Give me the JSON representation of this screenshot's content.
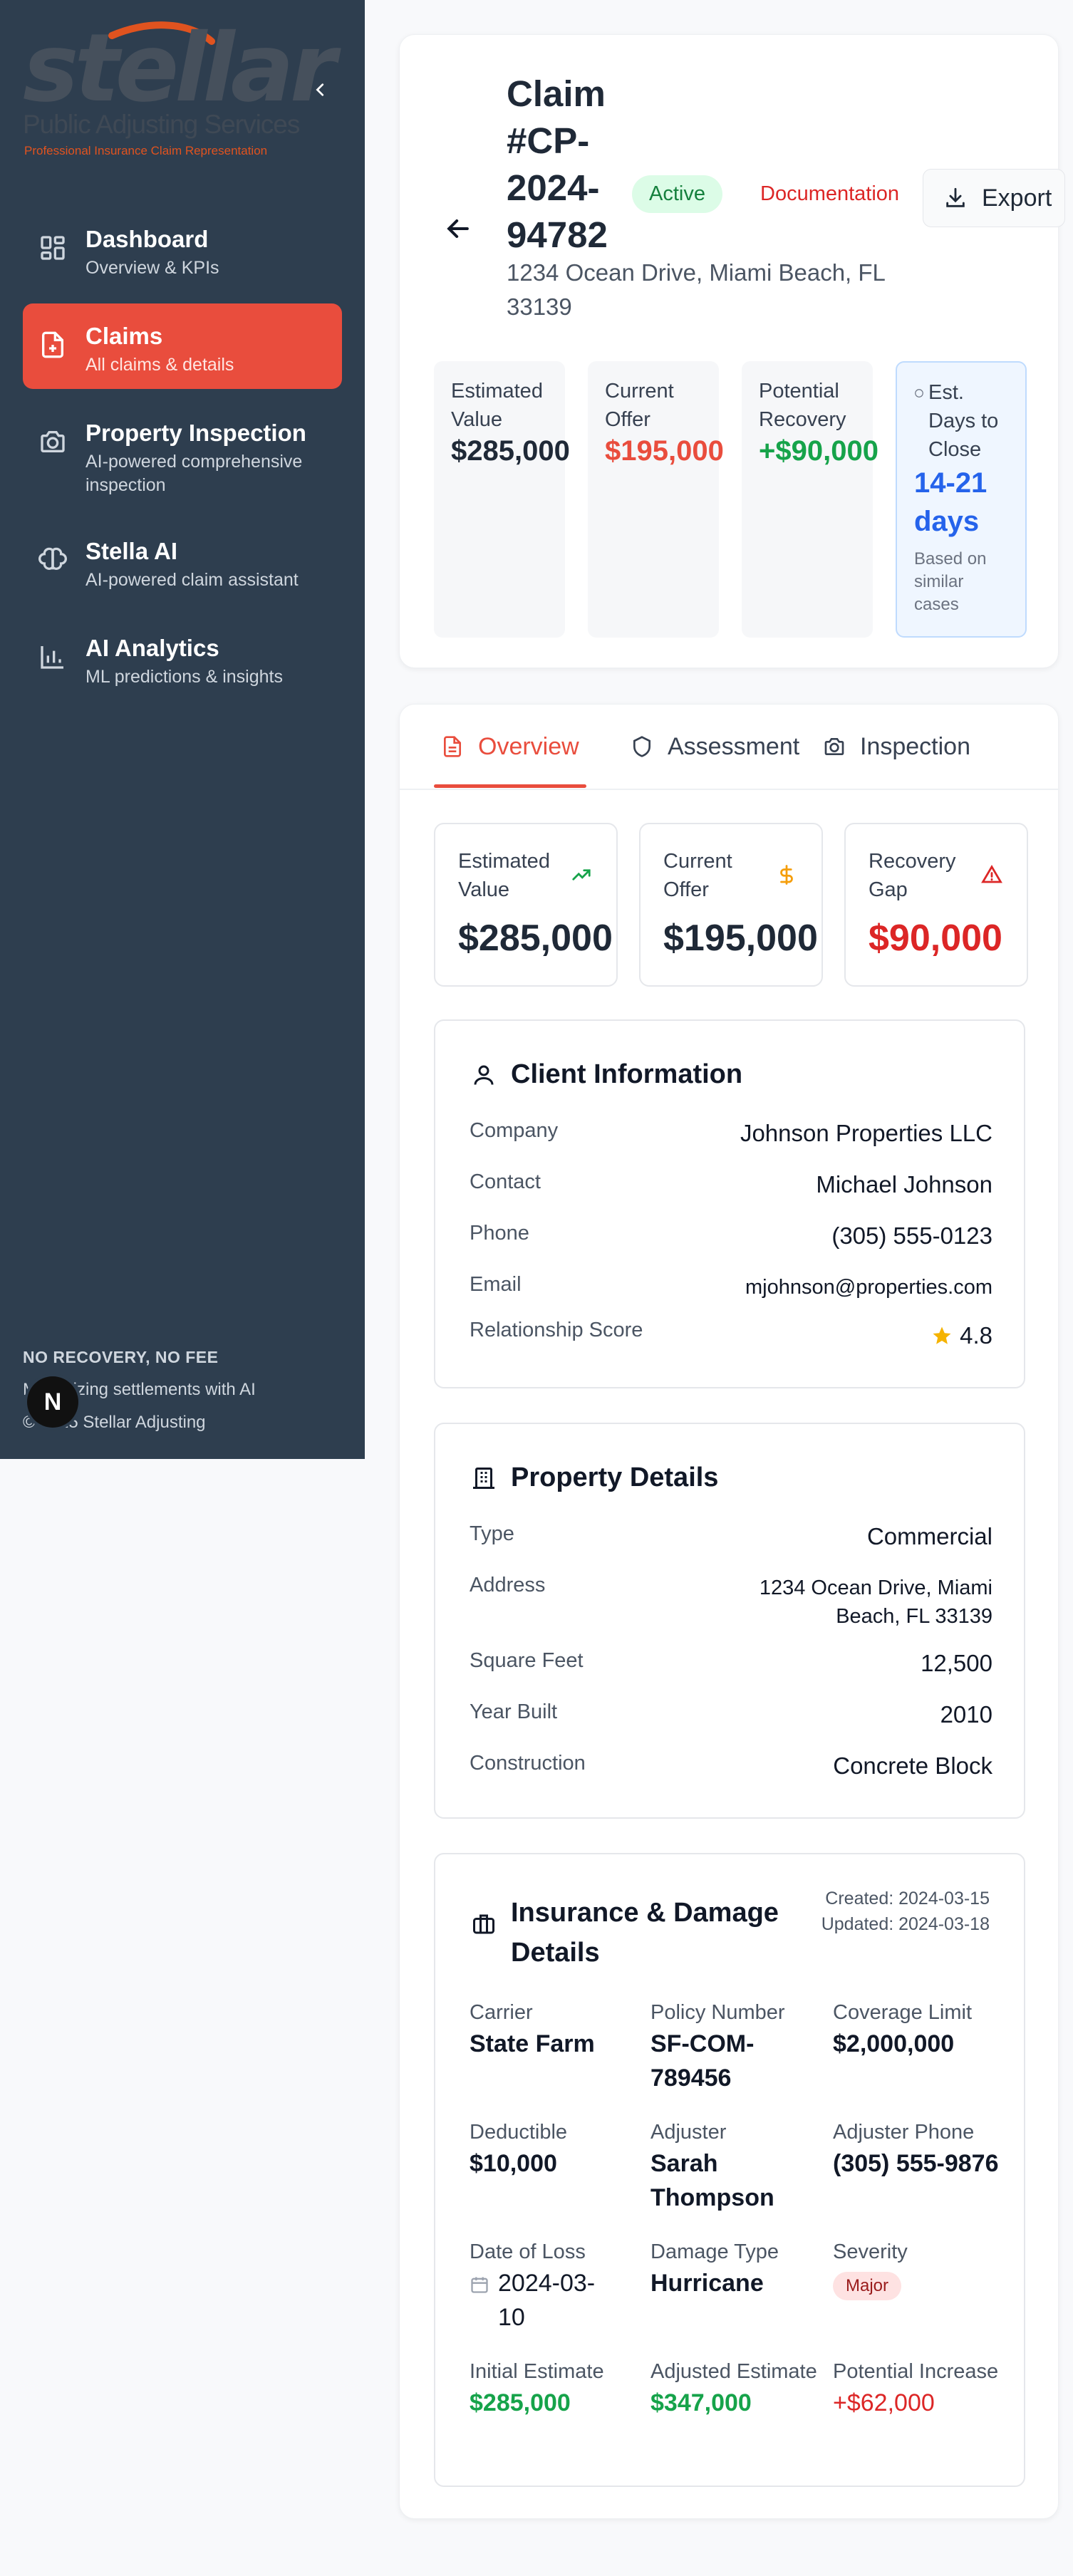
{
  "brand": {
    "logo_word": "stellar",
    "logo_sub": "Public Adjusting Services",
    "logo_tag": "Professional Insurance Claim Representation",
    "colors": {
      "sidebar": "#2e3e4f",
      "accent": "#e94d3d"
    }
  },
  "sidebar": {
    "items": [
      {
        "title": "Dashboard",
        "sub": "Overview & KPIs",
        "icon": "grid-icon"
      },
      {
        "title": "Claims",
        "sub": "All claims & details",
        "icon": "file-dollar-icon",
        "active": true
      },
      {
        "title": "Property Inspection",
        "sub": "AI-powered comprehensive inspection",
        "icon": "camera-icon"
      },
      {
        "title": "Stella AI",
        "sub": "AI-powered claim assistant",
        "icon": "brain-icon"
      },
      {
        "title": "AI Analytics",
        "sub": "ML predictions & insights",
        "icon": "bar-chart-icon"
      }
    ],
    "footer": {
      "line1": "NO RECOVERY, NO FEE",
      "line2": "Maximizing settlements with AI",
      "line3": "© 2025 Stellar Adjusting"
    },
    "badge": "N"
  },
  "header": {
    "claim_title": "Claim #CP-2024-94782",
    "status": "Active",
    "stage": "Documentation",
    "export_label": "Export",
    "address": "1234 Ocean Drive, Miami Beach, FL 33139",
    "stats": [
      {
        "label": "Estimated Value",
        "value": "$285,000",
        "color": "#1f2937"
      },
      {
        "label": "Current Offer",
        "value": "$195,000",
        "color": "#e94d3d"
      },
      {
        "label": "Potential Recovery",
        "value": "+$90,000",
        "color": "#16a34a"
      }
    ],
    "est_days": {
      "label": "Est. Days to Close",
      "value": "14-21 days",
      "note": "Based on similar cases"
    }
  },
  "tabs": [
    {
      "label": "Overview",
      "icon": "document-icon",
      "active": true
    },
    {
      "label": "Assessment",
      "icon": "shield-icon"
    },
    {
      "label": "Inspection",
      "icon": "camera-icon"
    }
  ],
  "kpis": [
    {
      "label": "Estimated Value",
      "value": "$285,000",
      "icon": "trending-up-icon",
      "color": "#1f2937"
    },
    {
      "label": "Current Offer",
      "value": "$195,000",
      "icon": "dollar-icon",
      "color": "#1f2937"
    },
    {
      "label": "Recovery Gap",
      "value": "$90,000",
      "icon": "alert-triangle-icon",
      "color": "#dc2626"
    }
  ],
  "client": {
    "title": "Client Information",
    "rows": [
      {
        "k": "Company",
        "v": "Johnson Properties LLC"
      },
      {
        "k": "Contact",
        "v": "Michael Johnson"
      },
      {
        "k": "Phone",
        "v": "(305) 555-0123"
      },
      {
        "k": "Email",
        "v": "mjohnson@properties.com"
      },
      {
        "k": "Relationship Score",
        "v": "4.8"
      }
    ]
  },
  "property": {
    "title": "Property Details",
    "rows": [
      {
        "k": "Type",
        "v": "Commercial"
      },
      {
        "k": "Address",
        "v": "1234 Ocean Drive, Miami Beach, FL 33139"
      },
      {
        "k": "Square Feet",
        "v": "12,500"
      },
      {
        "k": "Year Built",
        "v": "2010"
      },
      {
        "k": "Construction",
        "v": "Concrete Block"
      }
    ]
  },
  "insurance": {
    "title": "Insurance & Damage Details",
    "created": "Created: 2024-03-15",
    "updated": "Updated: 2024-03-18",
    "cells": [
      {
        "k": "Carrier",
        "v": "State Farm"
      },
      {
        "k": "Policy Number",
        "v": "SF-COM-789456"
      },
      {
        "k": "Coverage Limit",
        "v": "$2,000,000"
      },
      {
        "k": "Deductible",
        "v": "$10,000"
      },
      {
        "k": "Adjuster",
        "v": "Sarah Thompson"
      },
      {
        "k": "Adjuster Phone",
        "v": "(305) 555-9876"
      },
      {
        "k": "Date of Loss",
        "v": "2024-03-10"
      },
      {
        "k": "Damage Type",
        "v": "Hurricane"
      },
      {
        "k": "Severity",
        "v": "Major"
      },
      {
        "k": "Initial Estimate",
        "v": "$285,000"
      },
      {
        "k": "Adjusted Estimate",
        "v": "$347,000"
      },
      {
        "k": "Potential Increase",
        "v": "+$62,000"
      }
    ]
  }
}
